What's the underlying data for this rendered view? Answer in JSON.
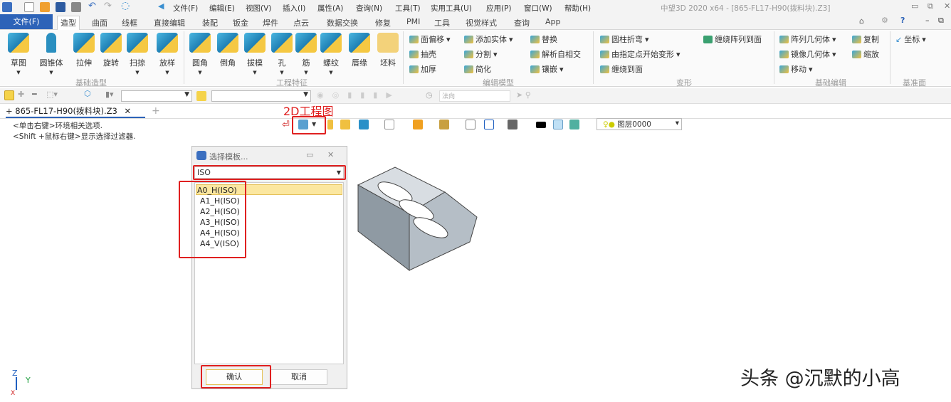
{
  "window": {
    "title": "中望3D 2020 x64 - [865-FL17-H90(拨料块).Z3]"
  },
  "menu": [
    "文件(F)",
    "编辑(E)",
    "视图(V)",
    "插入(I)",
    "属性(A)",
    "查询(N)",
    "工具(T)",
    "实用工具(U)",
    "应用(P)",
    "窗口(W)",
    "帮助(H)"
  ],
  "ribbon_tabs": [
    "文件(F)",
    "造型",
    "曲面",
    "线框",
    "直接编辑",
    "装配",
    "钣金",
    "焊件",
    "点云",
    "数据交换",
    "修复",
    "PMI",
    "工具",
    "视觉样式",
    "查询",
    "App"
  ],
  "groups": {
    "basic": {
      "label": "基础造型",
      "items": [
        "草图",
        "圆锥体",
        "拉伸",
        "旋转",
        "扫掠",
        "放样"
      ]
    },
    "eng": {
      "label": "工程特征",
      "items": [
        "圆角",
        "倒角",
        "拔模",
        "孔",
        "筋",
        "螺纹",
        "唇缘",
        "坯料"
      ]
    },
    "edit": {
      "label": "编辑模型",
      "items": [
        "面偏移",
        "抽壳",
        "加厚",
        "添加实体",
        "分割",
        "简化",
        "替换",
        "解析自相交",
        "镶嵌"
      ]
    },
    "deform": {
      "label": "变形",
      "items": [
        "圆柱折弯",
        "由指定点开始变形",
        "缠绕到面",
        "缠绕阵列到面"
      ]
    },
    "basicedit": {
      "label": "基础编辑",
      "items": [
        "阵列几何体",
        "镜像几何体",
        "移动",
        "复制",
        "缩放"
      ]
    },
    "datum": {
      "label": "基准面",
      "items": [
        "坐标"
      ]
    }
  },
  "toolbar": {
    "direction": "法向",
    "layer": "图层0000"
  },
  "doc_tab": {
    "label": "865-FL17-H90(拨料块).Z3"
  },
  "hints": [
    "<单击右键>环境相关选项.",
    "<Shift +鼠标右键>显示选择过滤器."
  ],
  "annotation": "2D工程图",
  "dialog": {
    "title": "选择模板...",
    "standard": "ISO",
    "templates": [
      "A0_H(ISO)",
      "A1_H(ISO)",
      "A2_H(ISO)",
      "A3_H(ISO)",
      "A4_H(ISO)",
      "A4_V(ISO)"
    ],
    "selected": "A0_H(ISO)",
    "ok": "确认",
    "cancel": "取消"
  },
  "axes": {
    "z": "Z",
    "y": "Y",
    "x": "X"
  },
  "watermark": "头条 @沉默的小高",
  "colors": {
    "accent": "#2d63b8",
    "highlight": "#e02020",
    "selected": "#fbe7a0"
  }
}
